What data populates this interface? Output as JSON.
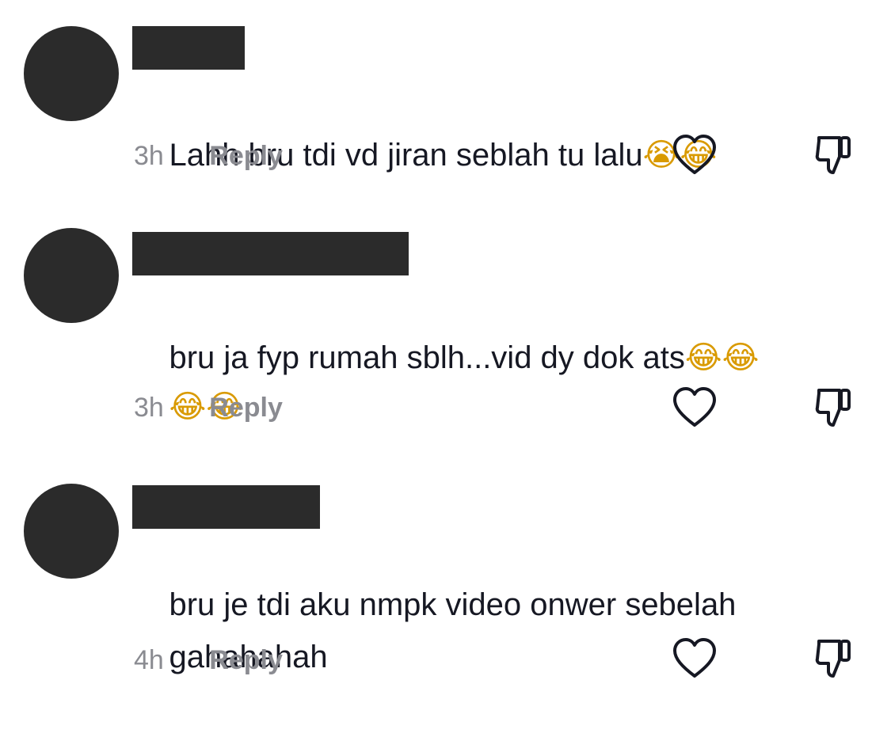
{
  "comments": [
    {
      "text": "Lahh bru tdi vd jiran seblah tu lalu",
      "emojis": "😭😂",
      "time": "3h",
      "reply_label": "Reply"
    },
    {
      "text": "bru ja fyp rumah sblh...vid dy dok ats",
      "emojis": "😂😂",
      "text_line2": "",
      "emojis_line2": "😂😂",
      "time": "3h",
      "reply_label": "Reply"
    },
    {
      "text": "bru je tdi aku nmpk video onwer sebelah",
      "text_line2": "gahahahah",
      "time": "4h",
      "reply_label": "Reply"
    }
  ],
  "icons": {
    "like": "heart-outline-icon",
    "dislike": "thumbs-down-outline-icon"
  },
  "colors": {
    "text": "#161823",
    "secondary": "#8a8b91",
    "redaction": "#2b2b2b"
  }
}
